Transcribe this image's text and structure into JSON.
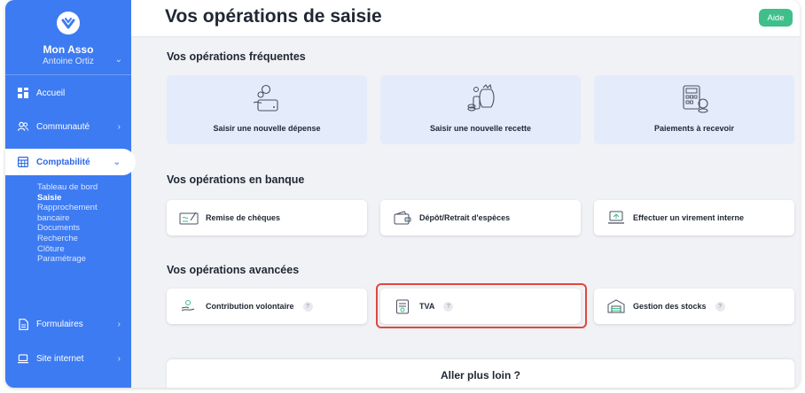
{
  "sidebar": {
    "org_name": "Mon Asso",
    "user_name": "Antoine Ortiz",
    "org_chevron": "⌄",
    "items": [
      {
        "label": "Accueil",
        "icon": "dashboard-icon"
      },
      {
        "label": "Communauté",
        "icon": "people-icon",
        "chevron": "›"
      },
      {
        "label": "Comptabilité",
        "icon": "calculator-icon",
        "chevron": "⌄",
        "active": true
      },
      {
        "label": "Formulaires",
        "icon": "document-icon",
        "chevron": "›"
      },
      {
        "label": "Site internet",
        "icon": "laptop-icon",
        "chevron": "›"
      }
    ],
    "subitems": [
      "Tableau de bord",
      "Saisie",
      "Rapprochement",
      "bancaire",
      "Documents",
      "Recherche",
      "Clôture",
      "Paramétrage"
    ],
    "current_subitem": "Saisie"
  },
  "header": {
    "title": "Vos opérations de saisie",
    "help_label": "Aide"
  },
  "sections": {
    "frequent": {
      "title": "Vos opérations fréquentes",
      "cards": [
        {
          "label": "Saisir une nouvelle dépense",
          "icon": "expense-illustration-icon"
        },
        {
          "label": "Saisir une nouvelle recette",
          "icon": "income-illustration-icon"
        },
        {
          "label": "Paiements à recevoir",
          "icon": "receivables-illustration-icon"
        }
      ]
    },
    "bank": {
      "title": "Vos opérations en banque",
      "cards": [
        {
          "label": "Remise de chèques",
          "icon": "cheque-icon"
        },
        {
          "label": "Dépôt/Retrait d'espèces",
          "icon": "wallet-icon"
        },
        {
          "label": "Effectuer un virement interne",
          "icon": "transfer-icon"
        }
      ]
    },
    "advanced": {
      "title": "Vos opérations avancées",
      "cards": [
        {
          "label": "Contribution volontaire",
          "icon": "hand-coin-icon",
          "help": "?"
        },
        {
          "label": "TVA",
          "icon": "vat-icon",
          "help": "?"
        },
        {
          "label": "Gestion des stocks",
          "icon": "warehouse-icon",
          "help": "?"
        }
      ]
    }
  },
  "footer_card": {
    "title": "Aller plus loin ?"
  },
  "colors": {
    "sidebar": "#3d7bf2",
    "accent": "#2a67e4",
    "help_button": "#3fbf8a",
    "highlight": "#e0483d",
    "frequent_card": "#e4ebfb"
  }
}
